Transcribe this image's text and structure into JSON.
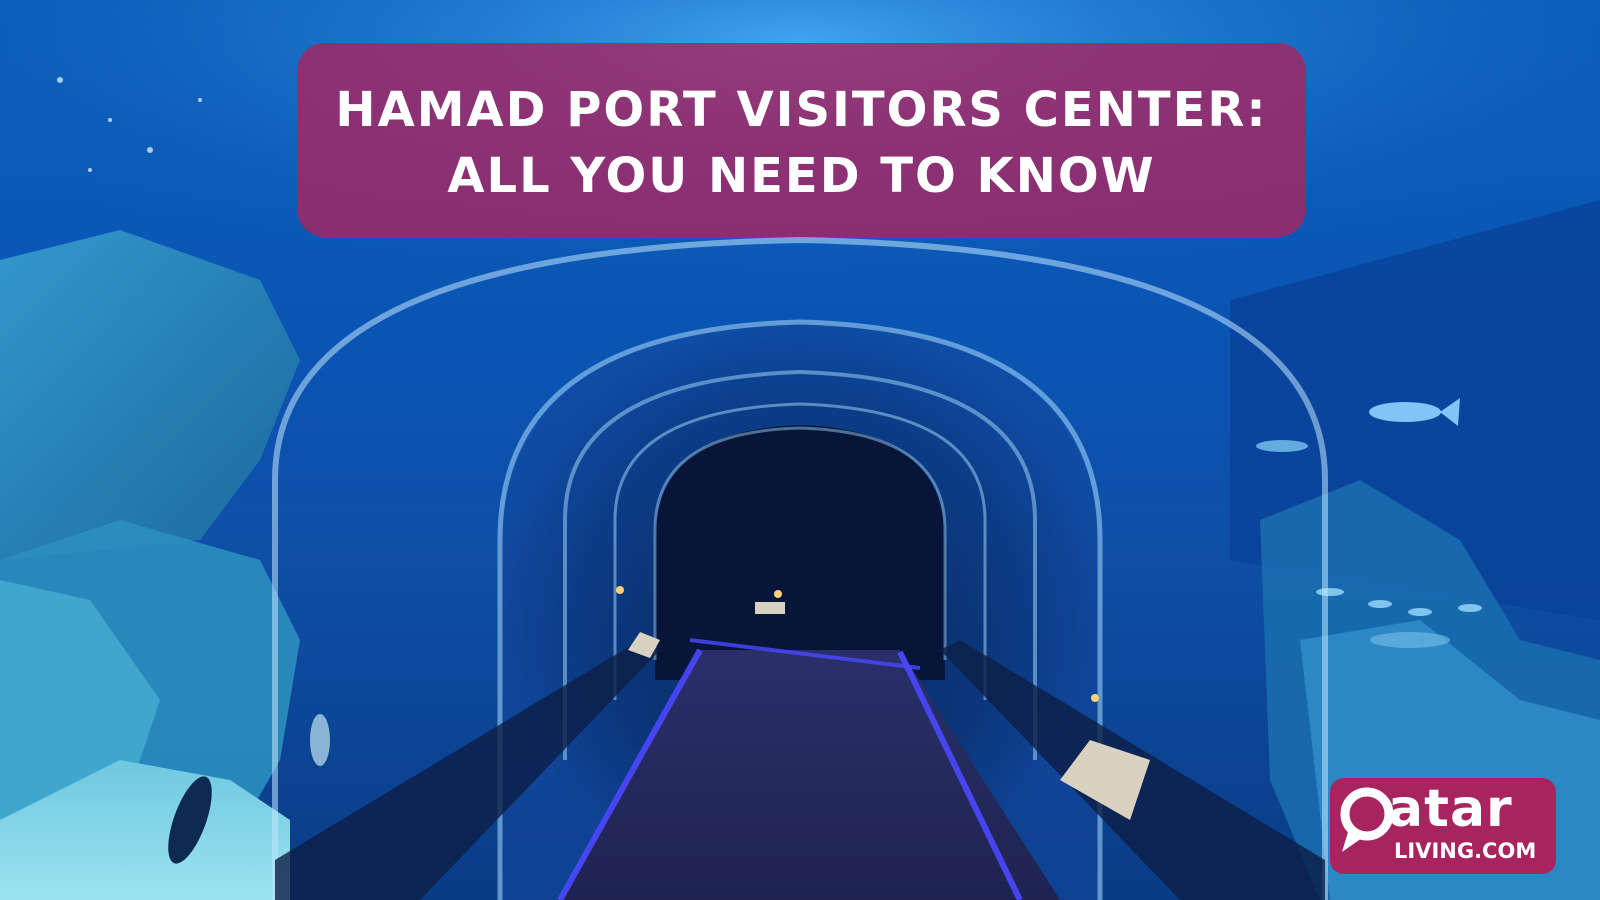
{
  "banner": {
    "line1": "Hamad Port Visitors Center:",
    "line2": "All You Need To Know"
  },
  "logo": {
    "word": "atar",
    "sub": "LIVING.COM",
    "icon": "q-speech-bubble-icon"
  },
  "colors": {
    "banner": "#a62462",
    "logo": "#a8245f",
    "water": "#0a4ea8",
    "floor_light": "#3a3cff"
  }
}
